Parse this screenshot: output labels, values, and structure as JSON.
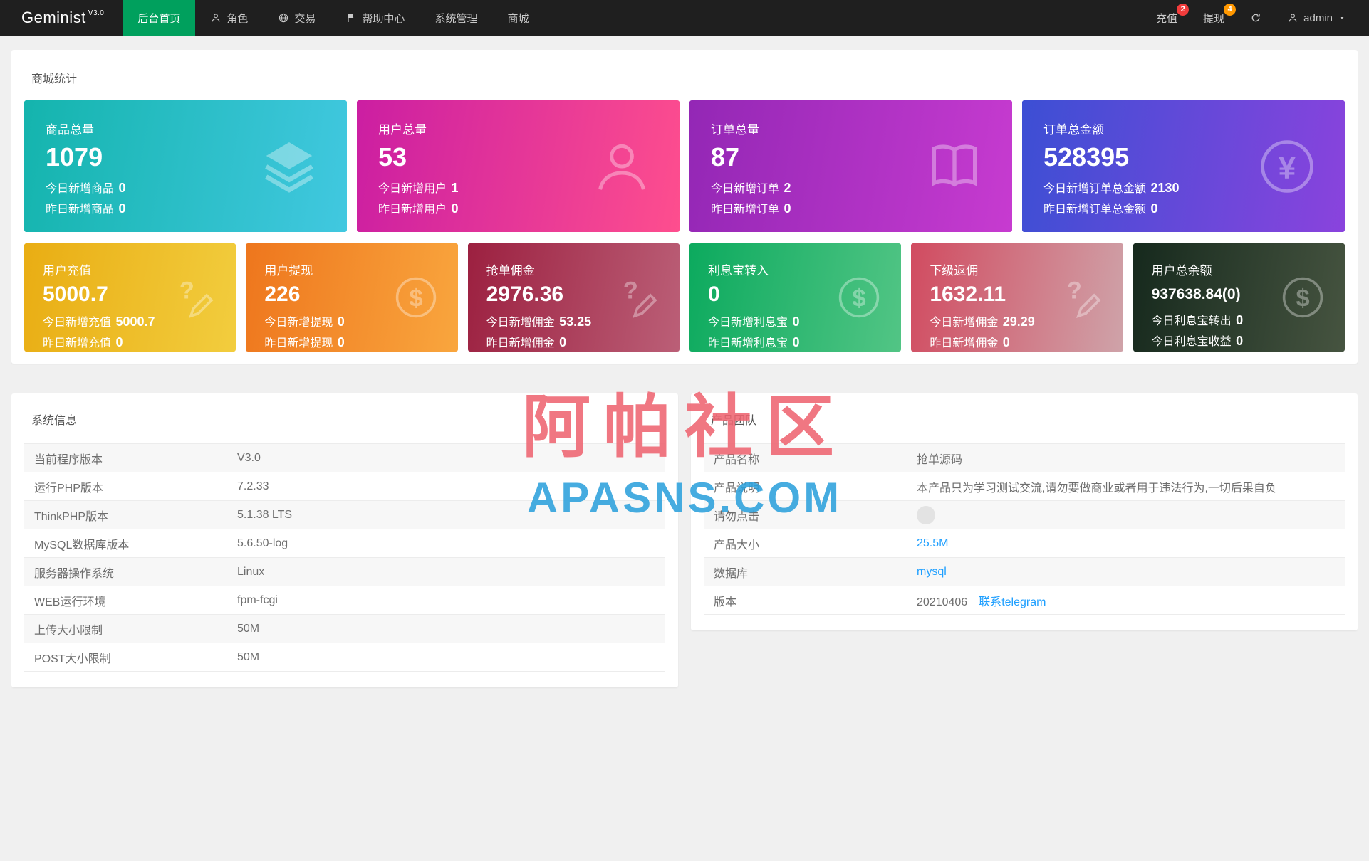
{
  "navbar": {
    "brand": "Geminist",
    "version": "V3.0",
    "active_color": "#00a05d",
    "menu": [
      {
        "id": "home",
        "label": "后台首页",
        "active": true
      },
      {
        "id": "role",
        "label": "角色",
        "icon": "person-icon"
      },
      {
        "id": "trade",
        "label": "交易",
        "icon": "globe-icon"
      },
      {
        "id": "help",
        "label": "帮助中心",
        "icon": "flag-icon"
      },
      {
        "id": "system",
        "label": "系统管理"
      },
      {
        "id": "mall",
        "label": "商城"
      }
    ],
    "recharge": {
      "label": "充值",
      "badge": "2",
      "badge_color": "#f23c3c"
    },
    "withdraw": {
      "label": "提现",
      "badge": "4",
      "badge_color": "#ff9800"
    },
    "user": {
      "label": "admin"
    }
  },
  "stats": {
    "title": "商城统计",
    "big_cards": [
      {
        "id": "goods-total",
        "title": "商品总量",
        "value": "1079",
        "icon": "layers-icon",
        "gradient": [
          "#14b4ad",
          "#41c8e0"
        ],
        "lines": [
          {
            "label": "今日新增商品",
            "value": "0"
          },
          {
            "label": "昨日新增商品",
            "value": "0"
          }
        ]
      },
      {
        "id": "users-total",
        "title": "用户总量",
        "value": "53",
        "icon": "user-big-icon",
        "gradient": [
          "#cb1ea2",
          "#fe4e8e"
        ],
        "lines": [
          {
            "label": "今日新增用户",
            "value": "1"
          },
          {
            "label": "昨日新增用户",
            "value": "0"
          }
        ]
      },
      {
        "id": "orders-total",
        "title": "订单总量",
        "value": "87",
        "icon": "book-icon",
        "gradient": [
          "#9327b5",
          "#c73bd0"
        ],
        "lines": [
          {
            "label": "今日新增订单",
            "value": "2"
          },
          {
            "label": "昨日新增订单",
            "value": "0"
          }
        ]
      },
      {
        "id": "amount-total",
        "title": "订单总金额",
        "value": "528395",
        "icon": "yen-circle-icon",
        "gradient": [
          "#3c4fd4",
          "#8a43dd"
        ],
        "lines": [
          {
            "label": "今日新增订单总金额",
            "value": "2130"
          },
          {
            "label": "昨日新增订单总金额",
            "value": "0"
          }
        ]
      }
    ],
    "small_cards": [
      {
        "id": "user-recharge",
        "title": "用户充值",
        "value": "5000.7",
        "icon": "edit-question-icon",
        "gradient": [
          "#e9ad13",
          "#f2cd3e"
        ],
        "lines": [
          {
            "label": "今日新增充值",
            "value": "5000.7"
          },
          {
            "label": "昨日新增充值",
            "value": "0"
          }
        ]
      },
      {
        "id": "user-withdraw",
        "title": "用户提现",
        "value": "226",
        "icon": "dollar-circle-icon",
        "gradient": [
          "#ee761d",
          "#f9a63e"
        ],
        "lines": [
          {
            "label": "今日新增提现",
            "value": "0"
          },
          {
            "label": "昨日新增提现",
            "value": "0"
          }
        ]
      },
      {
        "id": "grab-commission",
        "title": "抢单佣金",
        "value": "2976.36",
        "icon": "edit-question-icon",
        "gradient": [
          "#9c2040",
          "#bb5f77"
        ],
        "lines": [
          {
            "label": "今日新增佣金",
            "value": "53.25"
          },
          {
            "label": "昨日新增佣金",
            "value": "0"
          }
        ]
      },
      {
        "id": "interest-in",
        "title": "利息宝转入",
        "value": "0",
        "icon": "dollar-circle-icon",
        "gradient": [
          "#0caa5e",
          "#52c585"
        ],
        "lines": [
          {
            "label": "今日新增利息宝",
            "value": "0"
          },
          {
            "label": "昨日新增利息宝",
            "value": "0"
          }
        ]
      },
      {
        "id": "sub-rebate",
        "title": "下级返佣",
        "value": "1632.11",
        "icon": "edit-question-icon",
        "gradient": [
          "#d14b60",
          "#cfa3a9"
        ],
        "lines": [
          {
            "label": "今日新增佣金",
            "value": "29.29"
          },
          {
            "label": "昨日新增佣金",
            "value": "0"
          }
        ]
      },
      {
        "id": "user-balance",
        "title": "用户总余额",
        "value": "937638.84(0)",
        "compact": true,
        "icon": "dollar-circle-icon",
        "gradient": [
          "#16291d",
          "#465440"
        ],
        "lines": [
          {
            "label": "今日利息宝转出",
            "value": "0"
          },
          {
            "label": "今日利息宝收益",
            "value": "0"
          }
        ]
      }
    ]
  },
  "system_info": {
    "title": "系统信息",
    "rows": [
      {
        "label": "当前程序版本",
        "value": "V3.0"
      },
      {
        "label": "运行PHP版本",
        "value": "7.2.33"
      },
      {
        "label": "ThinkPHP版本",
        "value": "5.1.38 LTS"
      },
      {
        "label": "MySQL数据库版本",
        "value": "5.6.50-log"
      },
      {
        "label": "服务器操作系统",
        "value": "Linux"
      },
      {
        "label": "WEB运行环境",
        "value": "fpm-fcgi"
      },
      {
        "label": "上传大小限制",
        "value": "50M"
      },
      {
        "label": "POST大小限制",
        "value": "50M"
      }
    ]
  },
  "product_team": {
    "title": "产品团队",
    "rows": [
      {
        "label": "产品名称",
        "value": "抢单源码"
      },
      {
        "label": "产品说明",
        "value": "本产品只为学习测试交流,请勿要做商业或者用于违法行为,一切后果自负"
      },
      {
        "label": "请勿点击",
        "value": "",
        "type": "icon"
      },
      {
        "label": "产品大小",
        "value": "25.5M",
        "type": "link"
      },
      {
        "label": "数据库",
        "value": "mysql",
        "type": "link"
      },
      {
        "label": "版本",
        "value": "20210406",
        "link": "联系telegram"
      }
    ]
  },
  "watermark": {
    "title": "阿帕社区",
    "subtitle": "APASNS.COM",
    "title_color": "rgba(238,100,113,0.88)",
    "subtitle_color": "rgba(44,160,220,0.88)"
  }
}
